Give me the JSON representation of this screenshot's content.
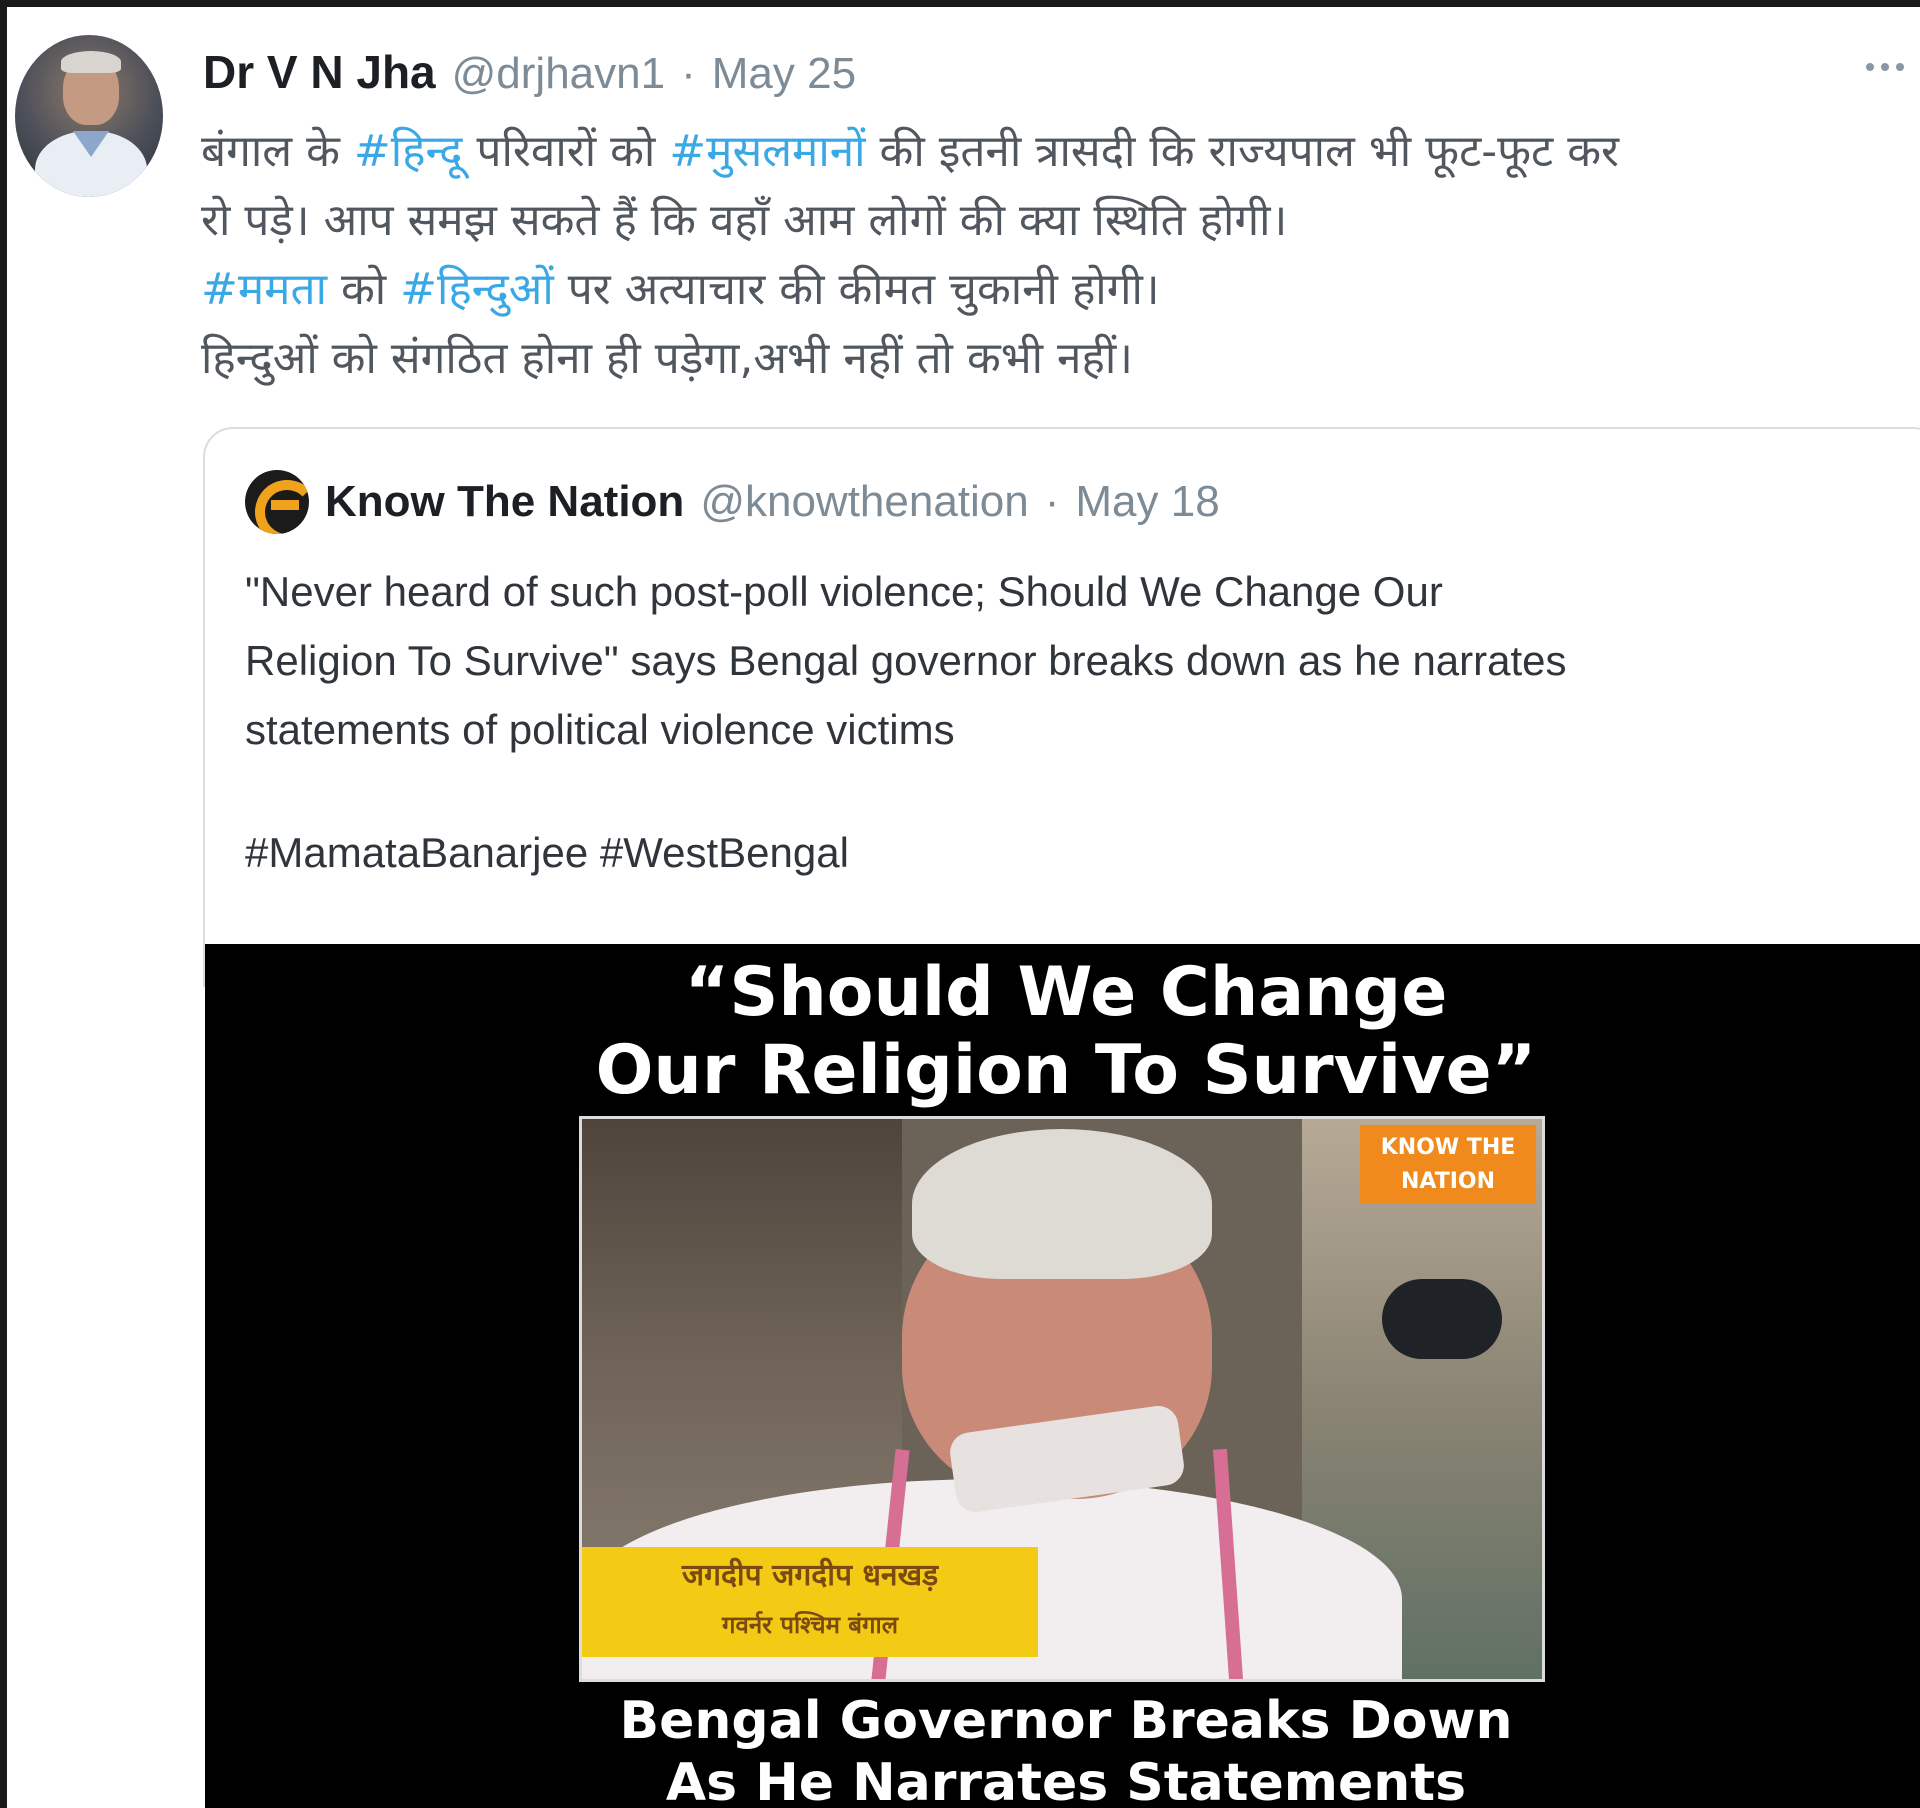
{
  "tweet": {
    "author_name": "Dr V N Jha",
    "author_handle": "@drjhavn1",
    "separator": "·",
    "date": "May 25",
    "more_icon": "more-horizontal-icon",
    "body": {
      "line1": {
        "t1": "बंगाल के ",
        "tag1": "#हिन्दू",
        "t2": " परिवारों को ",
        "tag2": "#मुसलमानों",
        "t3": " की इतनी त्रासदी कि राज्यपाल भी फूट-फूट कर"
      },
      "line2": "रो पड़े। आप समझ सकते हैं कि वहाँ आम लोगों की क्या स्थिति होगी।",
      "line3": {
        "tag1": "#ममता",
        "t1": " को ",
        "tag2": "#हिन्दुओं",
        "t2": " पर अत्याचार की कीमत चुकानी होगी।"
      },
      "line4": "हिन्दुओं को संगठित होना ही पड़ेगा,अभी नहीं तो कभी नहीं।"
    }
  },
  "quote": {
    "name": "Know The Nation",
    "handle": "@knowthenation",
    "separator": "·",
    "date": "May 18",
    "logo_icon": "know-the-nation-logo",
    "text_lines": [
      "\"Never heard of such post-poll violence; Should We Change Our",
      "Religion To Survive\" says Bengal governor breaks down as he narrates",
      "statements of political violence victims"
    ],
    "hashtags": "#MamataBanarjee #WestBengal"
  },
  "media": {
    "headline_line1": "“Should We Change",
    "headline_line2": "Our Religion To Survive”",
    "badge_line1": "KNOW THE",
    "badge_line2": "NATION",
    "caption_line1": "जगदीप जगदीप धनखड़",
    "caption_line2": "गवर्नर पश्चिम बंगाल",
    "subline_line1": "Bengal Governor Breaks Down",
    "subline_line2": "As He Narrates Statements"
  },
  "colors": {
    "hashtag": "#3ba8e6",
    "muted": "#7d8b97",
    "badge": "#f08a1c",
    "caption_bg": "#f3cb14"
  }
}
